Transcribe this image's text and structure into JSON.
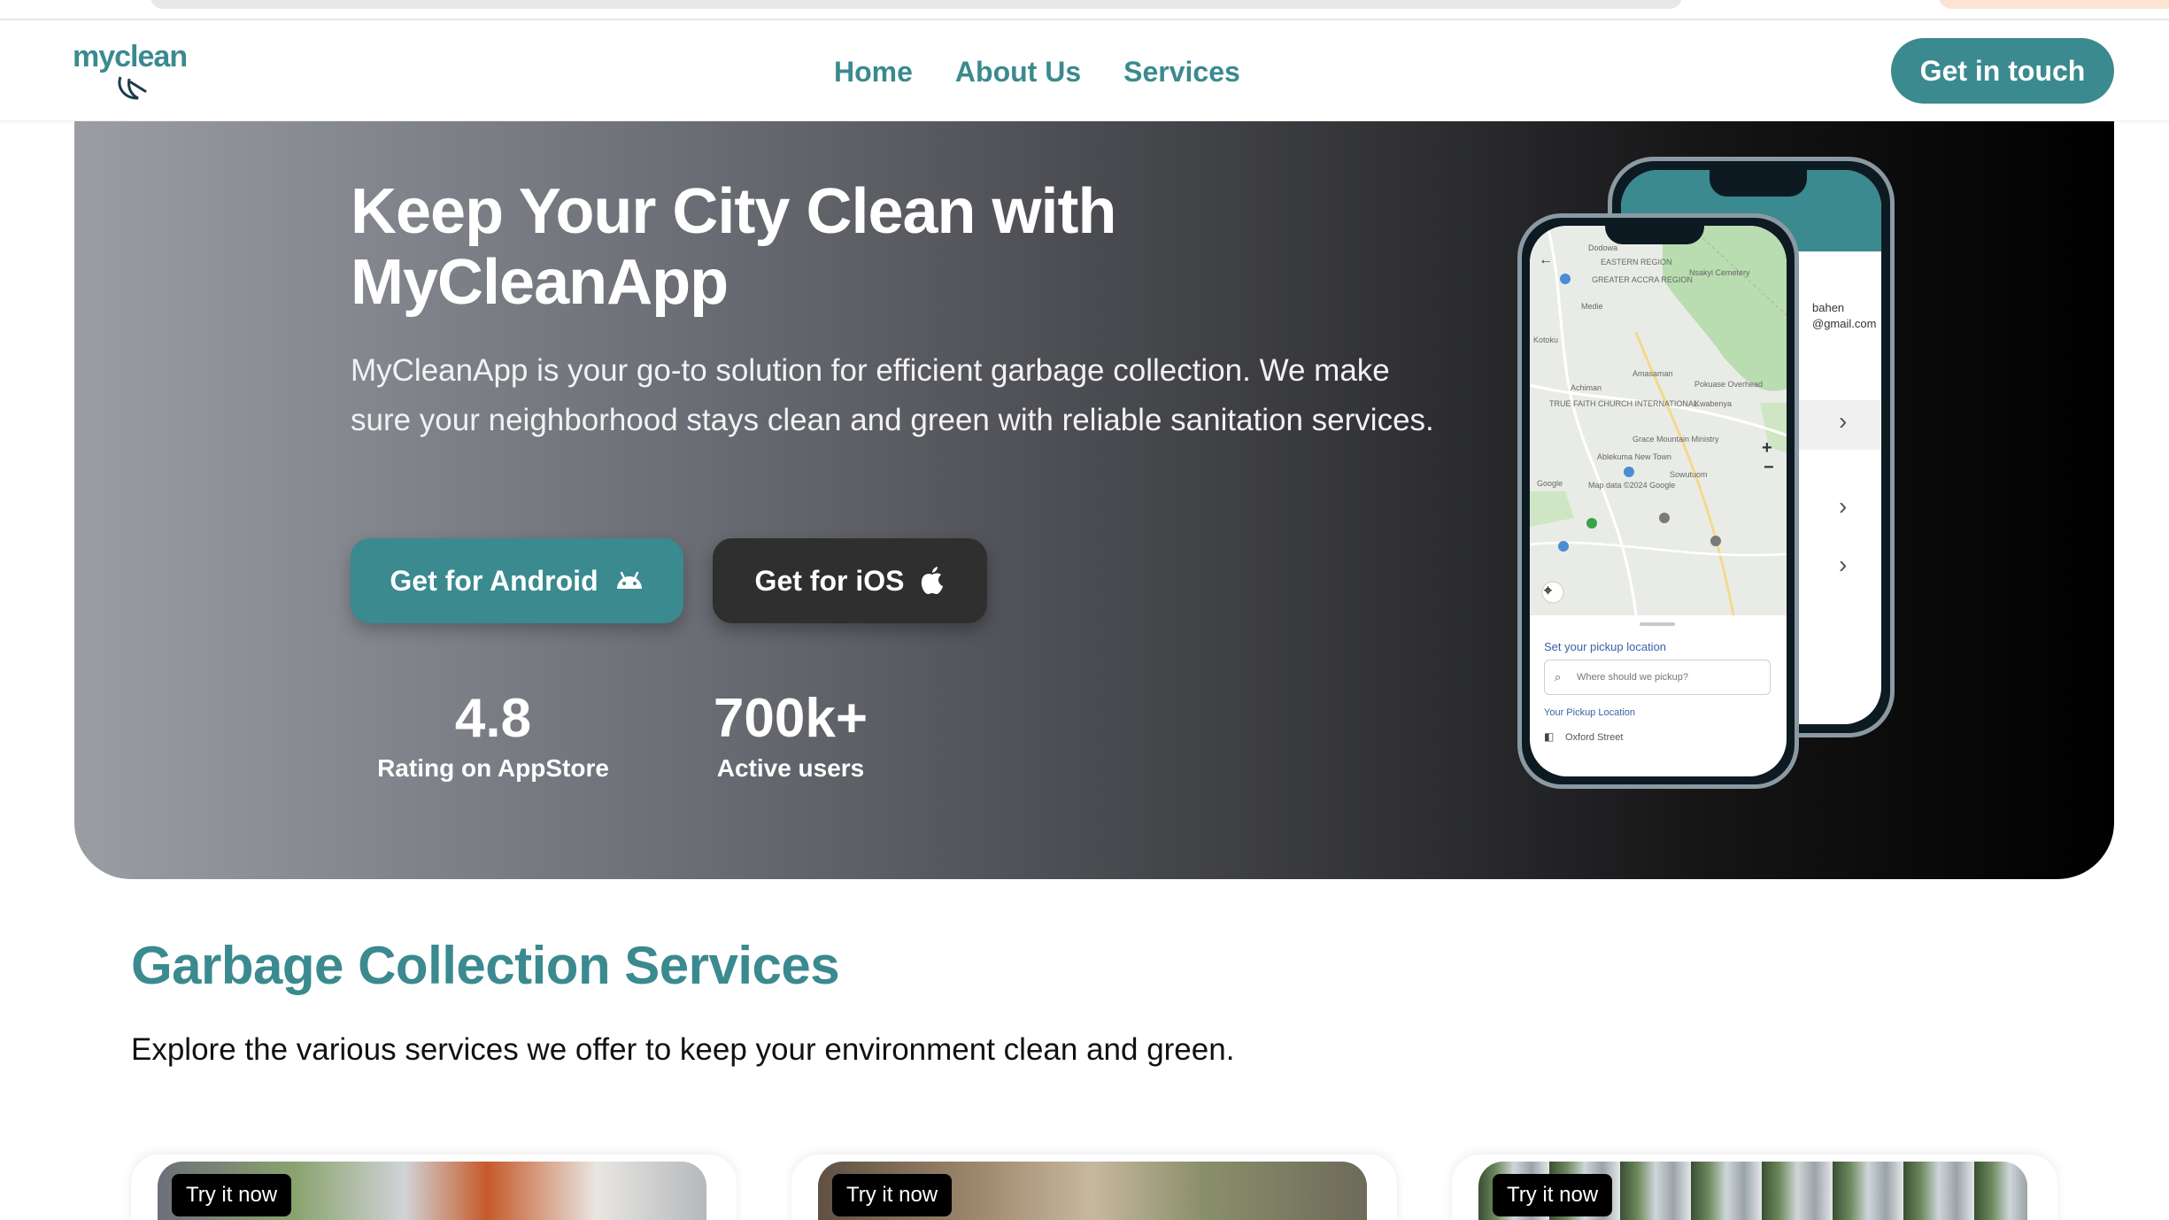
{
  "brand": {
    "name": "myclean",
    "color": "#3a8a8f"
  },
  "nav": {
    "links": [
      "Home",
      "About Us",
      "Services"
    ],
    "cta": "Get in touch"
  },
  "hero": {
    "title": "Keep Your City Clean with MyCleanApp",
    "subtitle": "MyCleanApp is your go-to solution for efficient garbage collection. We make sure your neighborhood stays clean and green with reliable sanitation services.",
    "android_button": "Get for Android",
    "ios_button": "Get for iOS",
    "stats": [
      {
        "value": "4.8",
        "label": "Rating on AppStore"
      },
      {
        "value": "700k+",
        "label": "Active users"
      }
    ]
  },
  "phone": {
    "map_labels": [
      "Dodowa",
      "EASTERN REGION",
      "GREATER ACCRA REGION",
      "Nsakyi Cemetery",
      "Medie",
      "Kotoku",
      "Amasaman",
      "Achiman",
      "TRUE FAITH CHURCH INTERNATIONAL",
      "Pokuase Overhead",
      "Kwabenya",
      "Grace Mountain Ministry",
      "Ablekuma New Town",
      "Sowutuom",
      "Google",
      "Map data ©2024 Google"
    ],
    "pickup_title": "Set your pickup location",
    "pickup_placeholder": "Where should we pickup?",
    "your_location_label": "Your Pickup Location",
    "location_value": "Oxford Street",
    "back_email": "@gmail.com",
    "back_name": "bahen"
  },
  "services": {
    "title": "Garbage Collection Services",
    "subtitle": "Explore the various services we offer to keep your environment clean and green.",
    "cards": [
      {
        "badge": "Try it now"
      },
      {
        "badge": "Try it now"
      },
      {
        "badge": "Try it now"
      }
    ]
  }
}
